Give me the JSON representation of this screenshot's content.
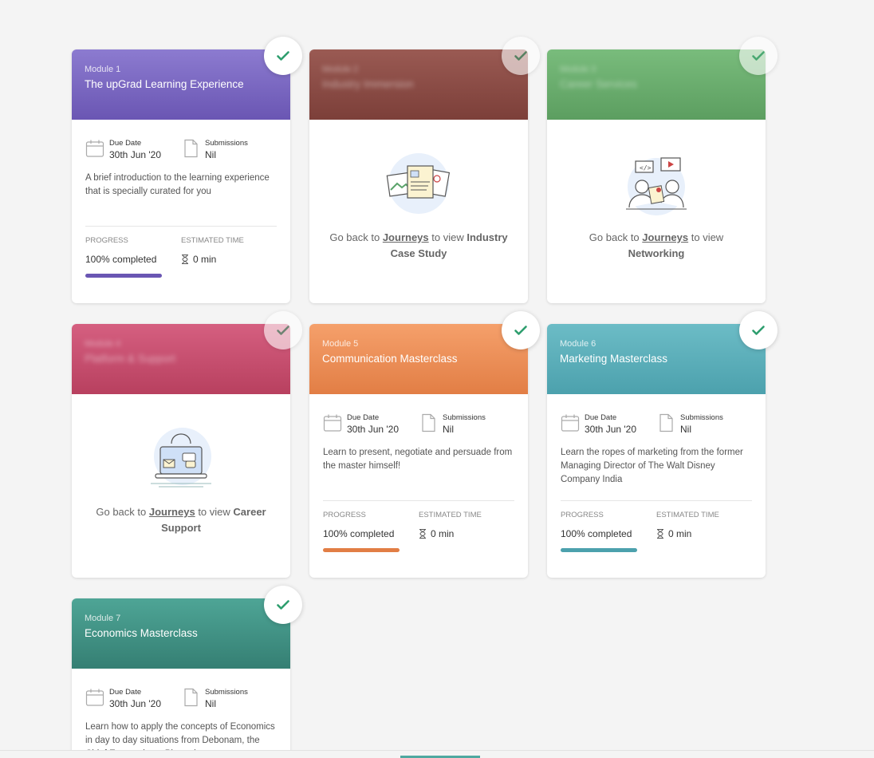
{
  "colors": {
    "purple": "#7a63c0",
    "maroon": "#8b4a44",
    "green": "#6aac6e",
    "pink": "#c84e6f",
    "orange": "#ea8a55",
    "teal": "#56aeb8",
    "darkteal": "#3e9183",
    "check": "#2e9e6e"
  },
  "labels": {
    "due_date": "Due Date",
    "submissions": "Submissions",
    "progress": "PROGRESS",
    "estimated_time": "ESTIMATED TIME",
    "go_back_prefix": "Go back to",
    "journeys": "Journeys",
    "to_view": "to view"
  },
  "modules": [
    {
      "module": "Module 1",
      "title": "The upGrad Learning Experience",
      "due_date": "30th Jun '20",
      "submissions": "Nil",
      "description": "A brief introduction to the learning experience that is specially curated for you",
      "progress_text": "100% completed",
      "progress": 1.0,
      "estimated_time": "0 min"
    },
    {
      "module": "Module 2",
      "title": "Industry Immersion",
      "locked_target_1": "Industry",
      "locked_target_2": "Case Study"
    },
    {
      "module": "Module 3",
      "title": "Career Services",
      "locked_target_1": "Networking"
    },
    {
      "module": "Module 4",
      "title": "Platform & Support",
      "locked_target_1": "Career",
      "locked_target_2": "Support"
    },
    {
      "module": "Module 5",
      "title": "Communication Masterclass",
      "due_date": "30th Jun '20",
      "submissions": "Nil",
      "description": "Learn to present, negotiate and persuade from the master himself!",
      "progress_text": "100% completed",
      "progress": 1.0,
      "estimated_time": "0 min"
    },
    {
      "module": "Module 6",
      "title": "Marketing Masterclass",
      "due_date": "30th Jun '20",
      "submissions": "Nil",
      "description": "Learn the ropes of marketing from the former Managing Director of The Walt Disney Company India",
      "progress_text": "100% completed",
      "progress": 1.0,
      "estimated_time": "0 min"
    },
    {
      "module": "Module 7",
      "title": "Economics Masterclass",
      "due_date": "30th Jun '20",
      "submissions": "Nil",
      "description": "Learn how to apply the concepts of Economics in day to day situations from Debonam, the Chief Economist at Piramal"
    }
  ]
}
